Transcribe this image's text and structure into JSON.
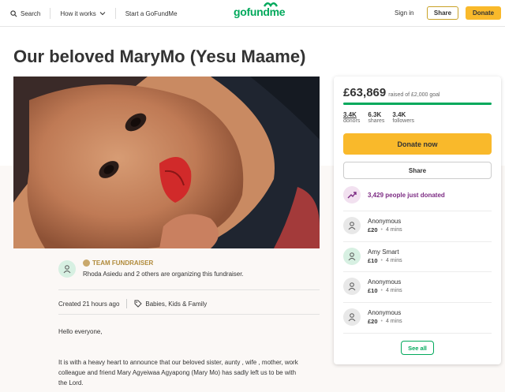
{
  "header": {
    "search_label": "Search",
    "how_it_works_label": "How it works",
    "start_label": "Start a GoFundMe",
    "logo_text": "gofundme",
    "signin_label": "Sign in",
    "share_label": "Share",
    "donate_label": "Donate"
  },
  "campaign": {
    "title": "Our beloved MaryMo (Yesu Maame)",
    "team_label": "TEAM FUNDRAISER",
    "organizer_text": "Rhoda Asiedu and 2 others are organizing this fundraiser.",
    "created_text": "Created 21 hours ago",
    "category": "Babies, Kids & Family",
    "story_greeting": "Hello everyone,",
    "story_line1": "It is with a heavy heart to announce that our beloved sister, aunty , wife , mother,  work",
    "story_line2": "colleague and friend Mary Agyeiwaa Agyapong (Mary Mo) has sadly left us to be with",
    "story_line3": "the Lord."
  },
  "sidebar": {
    "raised_amount": "£63,869",
    "raised_of": "raised of £2,000 goal",
    "progress_fraction": 1.0,
    "stats": [
      {
        "value": "3.4K",
        "label": "donors"
      },
      {
        "value": "6.3K",
        "label": "shares"
      },
      {
        "value": "3.4K",
        "label": "followers"
      }
    ],
    "donate_label": "Donate now",
    "share_label": "Share",
    "recent_text": "3,429 people just donated",
    "donations": [
      {
        "name": "Anonymous",
        "amount": "£20",
        "time": "4 mins"
      },
      {
        "name": "Amy Smart",
        "amount": "£10",
        "time": "4 mins"
      },
      {
        "name": "Anonymous",
        "amount": "£10",
        "time": "4 mins"
      },
      {
        "name": "Anonymous",
        "amount": "£20",
        "time": "4 mins"
      }
    ],
    "see_all_label": "See all"
  },
  "colors": {
    "brand_green": "#02a95c",
    "donate_yellow": "#f9b92b",
    "recent_purple": "#7c2b83"
  }
}
